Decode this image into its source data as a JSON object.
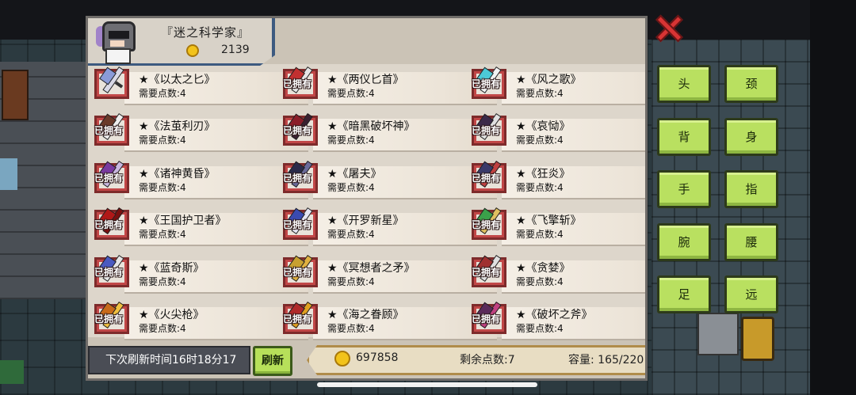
{
  "header": {
    "player_name": "『迷之科学家』",
    "coins": "2139"
  },
  "items": [
    {
      "name": "★《以太之匕》",
      "cost": "需要点数:4",
      "owned": "",
      "color": "#8a9ad8",
      "blade": "#d9d9e6"
    },
    {
      "name": "★《两仪匕首》",
      "cost": "需要点数:4",
      "owned": "已拥有",
      "color": "#c23030",
      "blade": "#e6e6e6"
    },
    {
      "name": "★《风之歌》",
      "cost": "需要点数:4",
      "owned": "已拥有",
      "color": "#4cc9d6",
      "blade": "#f2f2f2"
    },
    {
      "name": "★《法茧利刃》",
      "cost": "需要点数:4",
      "owned": "已拥有",
      "color": "#6a3a2a",
      "blade": "#eeeeee"
    },
    {
      "name": "★《暗黑破坏神》",
      "cost": "需要点数:4",
      "owned": "已拥有",
      "color": "#8b1e2a",
      "blade": "#3a2030"
    },
    {
      "name": "★《哀恸》",
      "cost": "需要点数:4",
      "owned": "已拥有",
      "color": "#3b2a4a",
      "blade": "#e0e0e0"
    },
    {
      "name": "★《诸神黄昏》",
      "cost": "需要点数:4",
      "owned": "已拥有",
      "color": "#7a3aa0",
      "blade": "#c9b7e0"
    },
    {
      "name": "★《屠夫》",
      "cost": "需要点数:4",
      "owned": "已拥有",
      "color": "#2a2a4a",
      "blade": "#6a6a9a"
    },
    {
      "name": "★《狂炎》",
      "cost": "需要点数:4",
      "owned": "已拥有",
      "color": "#3a3a6a",
      "blade": "#c04040"
    },
    {
      "name": "★《王国护卫者》",
      "cost": "需要点数:4",
      "owned": "已拥有",
      "color": "#b01818",
      "blade": "#7a1010"
    },
    {
      "name": "★《开罗新星》",
      "cost": "需要点数:4",
      "owned": "已拥有",
      "color": "#3a4ab0",
      "blade": "#e6e6f2"
    },
    {
      "name": "★《飞擎斩》",
      "cost": "需要点数:4",
      "owned": "已拥有",
      "color": "#3aa04a",
      "blade": "#e0c060"
    },
    {
      "name": "★《蓝奇斯》",
      "cost": "需要点数:4",
      "owned": "已拥有",
      "color": "#4a5ac0",
      "blade": "#e6e6e6"
    },
    {
      "name": "★《冥想者之矛》",
      "cost": "需要点数:4",
      "owned": "已拥有",
      "color": "#c8a030",
      "blade": "#e0b040"
    },
    {
      "name": "★《贪婪》",
      "cost": "需要点数:4",
      "owned": "已拥有",
      "color": "#a03030",
      "blade": "#e0e0e0"
    },
    {
      "name": "★《火尖枪》",
      "cost": "需要点数:4",
      "owned": "已拥有",
      "color": "#c86a1a",
      "blade": "#f0c040"
    },
    {
      "name": "★《海之眷顾》",
      "cost": "需要点数:4",
      "owned": "已拥有",
      "color": "#b02a2a",
      "blade": "#e0a020"
    },
    {
      "name": "★《破坏之斧》",
      "cost": "需要点数:4",
      "owned": "已拥有",
      "color": "#5a2a5a",
      "blade": "#c04080"
    }
  ],
  "footer": {
    "refresh_time": "下次刷新时间16时18分17",
    "refresh_label": "刷新",
    "gold": "697858",
    "points_left": "剩余点数:7",
    "capacity": "容量:   165/220"
  },
  "categories": [
    "头",
    "颈",
    "背",
    "身",
    "手",
    "指",
    "腕",
    "腰",
    "足",
    "远"
  ],
  "colors": {
    "accent_green": "#b9e060",
    "close_red": "#d83434",
    "owned_slot": "#c14747",
    "header_border": "#3d5a80"
  }
}
